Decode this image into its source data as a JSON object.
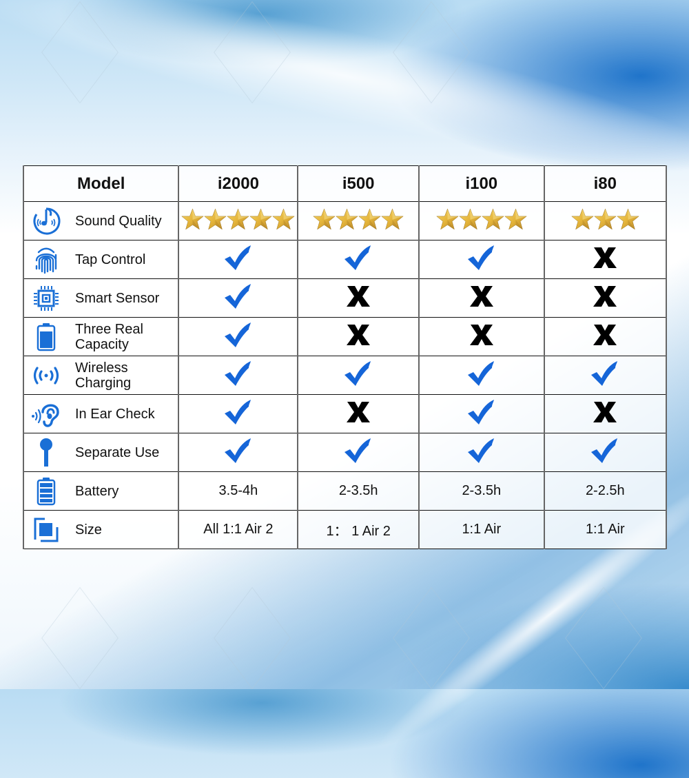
{
  "table": {
    "header": [
      "Model",
      "i2000",
      "i500",
      "i100",
      "i80"
    ],
    "colors": {
      "icon_blue": "#1a6fd6",
      "check_blue": "#1565d8",
      "cross_black": "#000000",
      "star_gold": "#e4b43a"
    },
    "rows": [
      {
        "feature": "Sound Quality",
        "icon": "music-note-icon",
        "type": "stars",
        "values": [
          5,
          4,
          4,
          3
        ]
      },
      {
        "feature": "Tap Control",
        "icon": "fingerprint-icon",
        "type": "mark",
        "values": [
          "check",
          "check",
          "check",
          "cross"
        ]
      },
      {
        "feature": "Smart Sensor",
        "icon": "chip-icon",
        "type": "mark",
        "values": [
          "check",
          "cross",
          "cross",
          "cross"
        ]
      },
      {
        "feature": "Three Real\nCapacity",
        "icon": "battery-full-icon",
        "type": "mark",
        "values": [
          "check",
          "cross",
          "cross",
          "cross"
        ]
      },
      {
        "feature": "Wireless\nCharging",
        "icon": "wireless-signal-icon",
        "type": "mark",
        "values": [
          "check",
          "check",
          "check",
          "check"
        ]
      },
      {
        "feature": "In Ear Check",
        "icon": "ear-icon",
        "type": "mark",
        "values": [
          "check",
          "cross",
          "check",
          "cross"
        ]
      },
      {
        "feature": "Separate Use",
        "icon": "single-earbud-icon",
        "type": "mark",
        "values": [
          "check",
          "check",
          "check",
          "check"
        ]
      },
      {
        "feature": "Battery",
        "icon": "battery-levels-icon",
        "type": "text",
        "values": [
          "3.5-4h",
          "2-3.5h",
          "2-3.5h",
          "2-2.5h"
        ]
      },
      {
        "feature": "Size",
        "icon": "size-square-icon",
        "type": "text",
        "values": [
          "All 1:1 Air 2",
          "1： 1 Air 2",
          "1:1 Air",
          "1:1 Air"
        ]
      }
    ]
  }
}
